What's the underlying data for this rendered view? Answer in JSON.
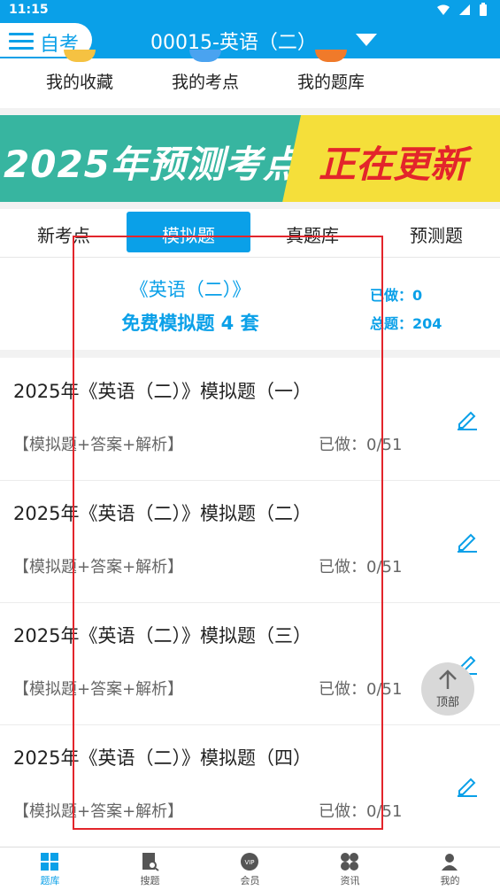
{
  "status_bar": {
    "time": "11:15"
  },
  "header": {
    "menu_label": "自考",
    "title": "00015-英语（二）"
  },
  "shortcuts": [
    {
      "label": "我的收藏",
      "color": "#f5c242"
    },
    {
      "label": "我的考点",
      "color": "#4aa3f0"
    },
    {
      "label": "我的题库",
      "color": "#f07a2a"
    }
  ],
  "banner": {
    "left_text": "2025年预测考点",
    "right_text": "正在更新"
  },
  "tabs": [
    {
      "label": "新考点",
      "active": false
    },
    {
      "label": "模拟题",
      "active": true
    },
    {
      "label": "真题库",
      "active": false
    },
    {
      "label": "预测题",
      "active": false
    }
  ],
  "summary": {
    "subject": "《英语（二）》",
    "subtitle": "免费模拟题 4 套",
    "done": "已做：0",
    "total": "总题：204"
  },
  "items": [
    {
      "title": "2025年《英语（二）》模拟题（一）",
      "tag": "【模拟题+答案+解析】",
      "progress": "已做：0/51"
    },
    {
      "title": "2025年《英语（二）》模拟题（二）",
      "tag": "【模拟题+答案+解析】",
      "progress": "已做：0/51"
    },
    {
      "title": "2025年《英语（二）》模拟题（三）",
      "tag": "【模拟题+答案+解析】",
      "progress": "已做：0/51"
    },
    {
      "title": "2025年《英语（二）》模拟题（四）",
      "tag": "【模拟题+答案+解析】",
      "progress": "已做：0/51"
    }
  ],
  "back_to_top": "顶部",
  "bottom_nav": [
    {
      "label": "题库",
      "active": true,
      "icon": "grid-icon"
    },
    {
      "label": "搜题",
      "active": false,
      "icon": "search-doc-icon"
    },
    {
      "label": "会员",
      "active": false,
      "icon": "vip-icon"
    },
    {
      "label": "资讯",
      "active": false,
      "icon": "apps-icon"
    },
    {
      "label": "我的",
      "active": false,
      "icon": "user-icon"
    }
  ],
  "colors": {
    "primary": "#0aa0e8",
    "highlight": "#e3252b"
  }
}
